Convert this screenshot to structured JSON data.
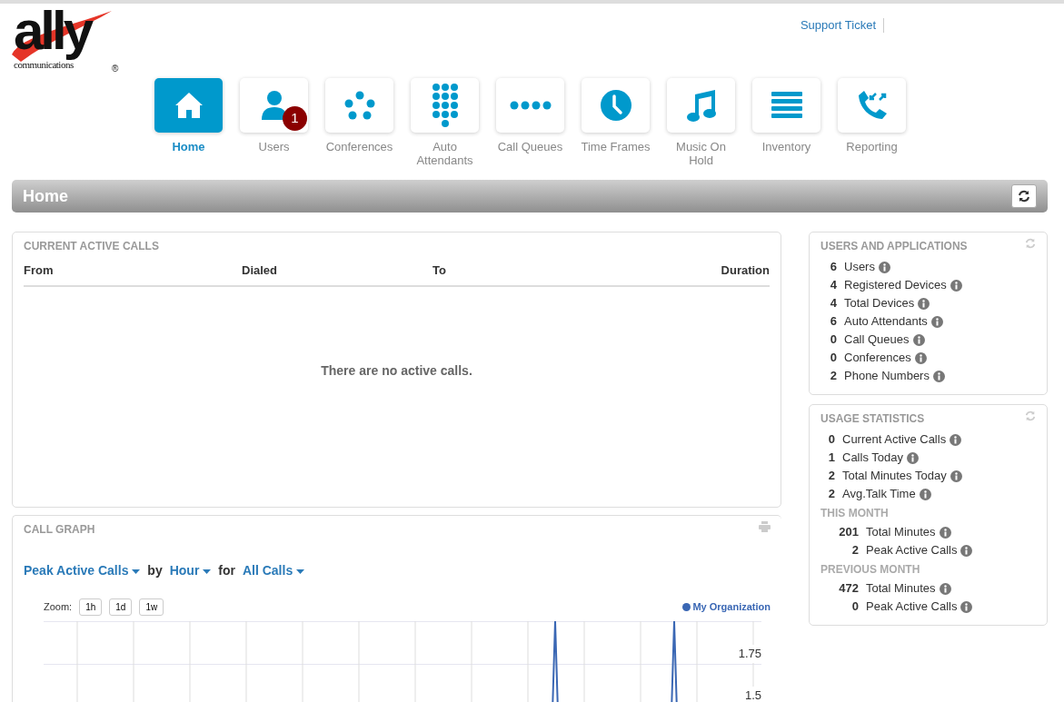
{
  "logo": {
    "word": "ally",
    "tagline": "communications",
    "mark": "®"
  },
  "header_links": [
    {
      "label": "Support Ticket"
    }
  ],
  "nav": [
    {
      "label": "Home",
      "selected": true
    },
    {
      "label": "Users",
      "selected": false,
      "badge": "1"
    },
    {
      "label": "Conferences",
      "selected": false
    },
    {
      "label": "Auto Attendants",
      "selected": false
    },
    {
      "label": "Call Queues",
      "selected": false
    },
    {
      "label": "Time Frames",
      "selected": false
    },
    {
      "label": "Music On Hold",
      "selected": false
    },
    {
      "label": "Inventory",
      "selected": false
    },
    {
      "label": "Reporting",
      "selected": false
    }
  ],
  "page_title": "Home",
  "active_calls": {
    "title": "CURRENT ACTIVE CALLS",
    "columns": [
      "From",
      "Dialed",
      "To",
      "Duration"
    ],
    "empty_message": "There are no active calls."
  },
  "call_graph": {
    "title": "CALL GRAPH",
    "selectors": [
      {
        "kind": "dropdown",
        "text": "Peak Active Calls"
      },
      {
        "kind": "word",
        "text": "by"
      },
      {
        "kind": "dropdown",
        "text": "Hour"
      },
      {
        "kind": "word",
        "text": "for"
      },
      {
        "kind": "dropdown",
        "text": "All Calls"
      }
    ],
    "zoom_label": "Zoom:",
    "zoom_buttons": [
      "1h",
      "1d",
      "1w"
    ],
    "legend": {
      "name": "My Organization",
      "color": "#3a67b4"
    },
    "y_labels": [
      "1.75",
      "1.5"
    ]
  },
  "users_apps": {
    "title": "USERS AND APPLICATIONS",
    "items": [
      {
        "count": "6",
        "label": "Users"
      },
      {
        "count": "4",
        "label": "Registered Devices"
      },
      {
        "count": "4",
        "label": "Total Devices"
      },
      {
        "count": "6",
        "label": "Auto Attendants"
      },
      {
        "count": "0",
        "label": "Call Queues"
      },
      {
        "count": "0",
        "label": "Conferences"
      },
      {
        "count": "2",
        "label": "Phone Numbers"
      }
    ]
  },
  "usage": {
    "title": "USAGE STATISTICS",
    "items": [
      {
        "count": "0",
        "label": "Current Active Calls"
      },
      {
        "count": "1",
        "label": "Calls Today"
      },
      {
        "count": "2",
        "label": "Total Minutes Today"
      },
      {
        "count": "2",
        "label": "Avg.Talk Time"
      }
    ],
    "sections": [
      {
        "title": "THIS MONTH",
        "items": [
          {
            "count": "201",
            "label": "Total Minutes"
          },
          {
            "count": "2",
            "label": "Peak Active Calls"
          }
        ]
      },
      {
        "title": "PREVIOUS MONTH",
        "items": [
          {
            "count": "472",
            "label": "Total Minutes"
          },
          {
            "count": "0",
            "label": "Peak Active Calls"
          }
        ]
      }
    ]
  }
}
